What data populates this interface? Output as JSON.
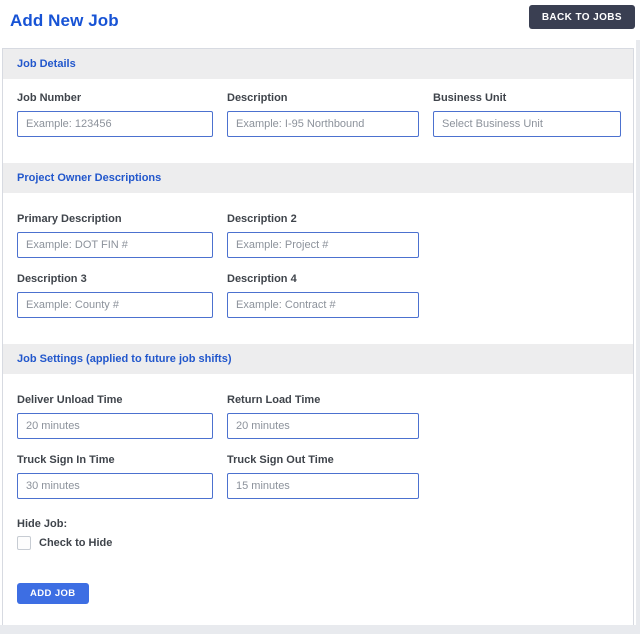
{
  "page": {
    "title": "Add New Job",
    "back_button_label": "BACK TO JOBS"
  },
  "colors": {
    "title_blue": "#1753d5",
    "section_title_blue": "#2257cc",
    "input_border_blue": "#4c71cf",
    "add_job_button_blue": "#3d6ee3",
    "back_button_dark": "#3a3f52",
    "section_bar_gray": "#ededee",
    "label_dark": "#3f444b",
    "placeholder_gray": "#8c929b"
  },
  "sections": [
    {
      "title": "Job Details",
      "fields": [
        {
          "label": "Job Number",
          "placeholder": "Example: 123456"
        },
        {
          "label": "Description",
          "placeholder": "Example: I-95 Northbound"
        },
        {
          "label": "Business Unit",
          "placeholder": "Select Business Unit"
        }
      ]
    },
    {
      "title": "Project Owner Descriptions",
      "fields": [
        {
          "label": "Primary Description",
          "placeholder": "Example: DOT FIN #"
        },
        {
          "label": "Description 2",
          "placeholder": "Example: Project #"
        },
        {
          "label": "Description 3",
          "placeholder": "Example: County #"
        },
        {
          "label": "Description 4",
          "placeholder": "Example: Contract #"
        }
      ]
    },
    {
      "title": "Job Settings (applied to future job shifts)",
      "fields": [
        {
          "label": "Deliver Unload Time",
          "value": "20 minutes"
        },
        {
          "label": "Return Load Time",
          "value": "20 minutes"
        },
        {
          "label": "Truck Sign In Time",
          "value": "30 minutes"
        },
        {
          "label": "Truck Sign Out Time",
          "value": "15 minutes"
        }
      ],
      "hide_job": {
        "label": "Hide Job:",
        "checkbox_label": "Check to Hide",
        "checked": false
      },
      "submit_label": "ADD JOB"
    }
  ]
}
